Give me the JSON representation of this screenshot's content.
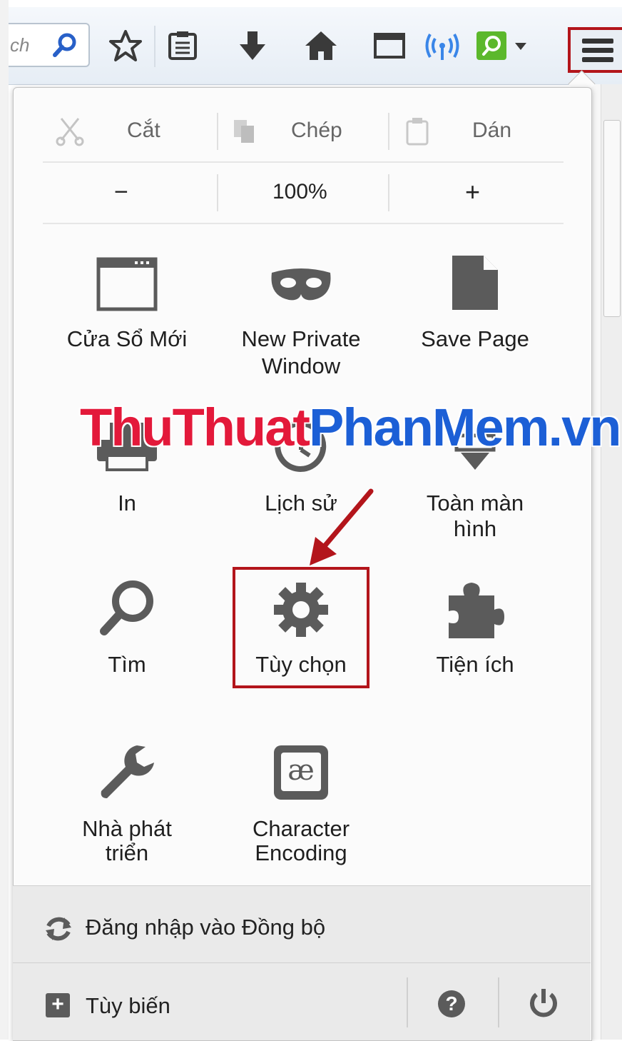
{
  "toolbar": {
    "search_partial": "ch",
    "icons": [
      "search-icon",
      "bookmark-star-icon",
      "reading-list-icon",
      "download-icon",
      "home-icon",
      "window-icon",
      "wifi-signal-icon",
      "green-addon-icon",
      "hamburger-menu-icon"
    ]
  },
  "edit_row": {
    "cut": "Cắt",
    "copy": "Chép",
    "paste": "Dán"
  },
  "zoom_row": {
    "minus": "−",
    "level": "100%",
    "plus": "+"
  },
  "items": {
    "new_window": "Cửa Sổ Mới",
    "private_line1": "New Private",
    "private_line2": "Window",
    "save_page": "Save Page",
    "print": "In",
    "history": "Lịch sử",
    "fullscreen_line1": "Toàn màn",
    "fullscreen_line2": "hình",
    "find": "Tìm",
    "options": "Tùy chọn",
    "addons": "Tiện ích",
    "developer_line1": "Nhà phát",
    "developer_line2": "triển",
    "encoding_line1": "Character",
    "encoding_line2": "Encoding",
    "encoding_glyph": "æ"
  },
  "footer": {
    "sync": "Đăng nhập vào Đồng bộ",
    "customize": "Tùy biến",
    "help_glyph": "?",
    "plus_glyph": "+"
  },
  "watermark": {
    "part1": "ThuThuat",
    "part2": "PhanMem.vn"
  },
  "colors": {
    "highlight": "#b3151b",
    "icon_gray": "#5b5b5b",
    "watermark_red": "#e3193a",
    "watermark_blue": "#1c5fd6"
  }
}
